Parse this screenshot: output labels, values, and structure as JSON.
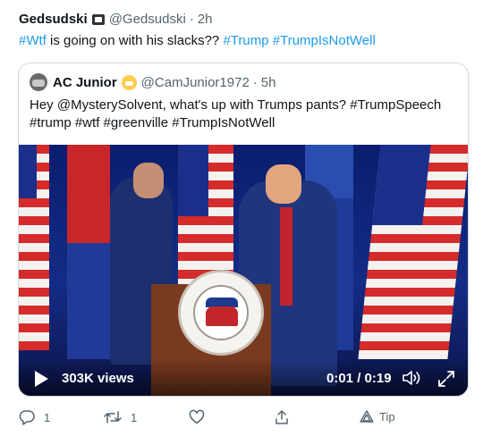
{
  "tweet": {
    "name": "Gedsudski",
    "badge_icon": "skull-badge-icon",
    "handle": "@Gedsudski",
    "dot": "·",
    "time": "2h",
    "text": {
      "tag1": "#Wtf",
      "middle": " is going on with his slacks?? ",
      "tag2": "#Trump",
      "space": " ",
      "tag3": "#TrumpIsNotWell"
    }
  },
  "quoted": {
    "name": "AC Junior",
    "emoji_icon": "grimacing-face-emoji",
    "handle": "@CamJunior1972",
    "dot": "·",
    "time": "5h",
    "text": "Hey @MysterySolvent, what's up with Trumps pants? #TrumpSpeech #trump #wtf #greenville #TrumpIsNotWell",
    "video": {
      "views": "303K views",
      "time": "0:01 / 0:19"
    }
  },
  "actions": {
    "reply_count": "1",
    "retweet_count": "1",
    "tip_label": "Tip"
  },
  "colors": {
    "link": "#1d9bf0",
    "muted": "#536471",
    "text": "#0f1419",
    "border": "#cfd9de"
  }
}
